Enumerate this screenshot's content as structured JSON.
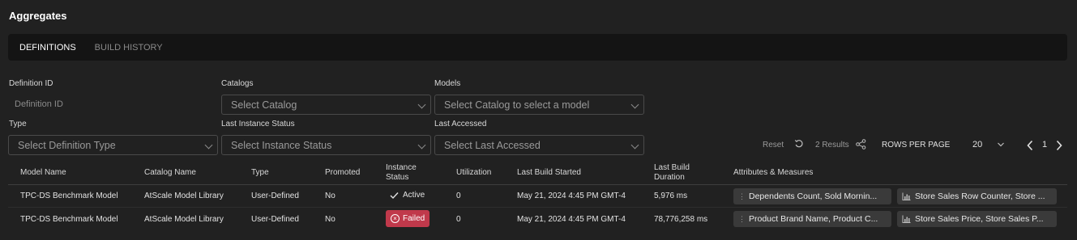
{
  "page": {
    "title": "Aggregates"
  },
  "tabs": [
    {
      "label": "DEFINITIONS",
      "active": true
    },
    {
      "label": "BUILD HISTORY",
      "active": false
    }
  ],
  "filters": {
    "definition_id": {
      "label": "Definition ID",
      "placeholder": "Definition ID"
    },
    "catalogs": {
      "label": "Catalogs",
      "value": "Select Catalog"
    },
    "models": {
      "label": "Models",
      "value": "Select Catalog to select a model"
    },
    "type": {
      "label": "Type",
      "value": "Select Definition Type"
    },
    "last_instance_status": {
      "label": "Last Instance Status",
      "value": "Select Instance Status"
    },
    "last_accessed": {
      "label": "Last Accessed",
      "value": "Select Last Accessed"
    }
  },
  "toolbar": {
    "reset_label": "Reset",
    "results_text": "2 Results",
    "rows_per_page_label": "ROWS PER PAGE",
    "rows_per_page_value": "20",
    "page_number": "1"
  },
  "table": {
    "headers": {
      "model_name": "Model Name",
      "catalog_name": "Catalog Name",
      "type": "Type",
      "promoted": "Promoted",
      "instance_status_1": "Instance",
      "instance_status_2": "Status",
      "utilization": "Utilization",
      "last_build_started": "Last Build Started",
      "last_build_duration_1": "Last Build",
      "last_build_duration_2": "Duration",
      "attributes_measures": "Attributes & Measures"
    },
    "rows": [
      {
        "model_name": "TPC-DS Benchmark Model",
        "catalog_name": "AtScale Model Library",
        "type": "User-Defined",
        "promoted": "No",
        "instance_status": "Active",
        "utilization": "0",
        "last_build_started": "May 21, 2024 4:45 PM GMT-4",
        "last_build_duration": "5,976 ms",
        "attributes": "Dependents Count, Sold Mornin...",
        "measures": "Store Sales Row Counter, Store ..."
      },
      {
        "model_name": "TPC-DS Benchmark Model",
        "catalog_name": "AtScale Model Library",
        "type": "User-Defined",
        "promoted": "No",
        "instance_status": "Failed",
        "utilization": "0",
        "last_build_started": "May 21, 2024 4:45 PM GMT-4",
        "last_build_duration": "78,776,258 ms",
        "attributes": "Product Brand Name, Product C...",
        "measures": "Store Sales Price, Store Sales P..."
      }
    ]
  },
  "colors": {
    "background": "#212121",
    "tab_bar": "#141414",
    "failed_badge": "#c0394b",
    "chip": "#3a3a3a"
  }
}
